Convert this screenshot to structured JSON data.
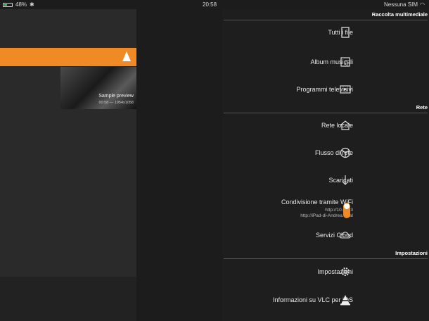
{
  "status_bar": {
    "battery": "48%",
    "time": "20:58",
    "carrier": "Nessuna SIM"
  },
  "content": {
    "preview_title": "Sample preview",
    "preview_meta": "00:58 — 1954x1058"
  },
  "menu": {
    "sections": {
      "media": "Raccolta multimediale",
      "network": "Rete",
      "settings": "Impostazioni"
    },
    "items": {
      "all_files": "Tutti i file",
      "music_albums": "Album musicali",
      "tv_shows": "Programmi televisivi",
      "local_network": "Rete locale",
      "network_stream": "Flusso di rete",
      "downloads": "Scaricati",
      "wifi_share": "Condivisione tramite WiFi",
      "wifi_url_1": "http://10.0.1.3",
      "wifi_url_2": "http://iPad-di-Andrea.local",
      "cloud": "Servizi Cloud",
      "settings": "Impostazioni",
      "about": "Informazioni su VLC per iOS"
    }
  },
  "colors": {
    "accent": "#f08a24"
  }
}
